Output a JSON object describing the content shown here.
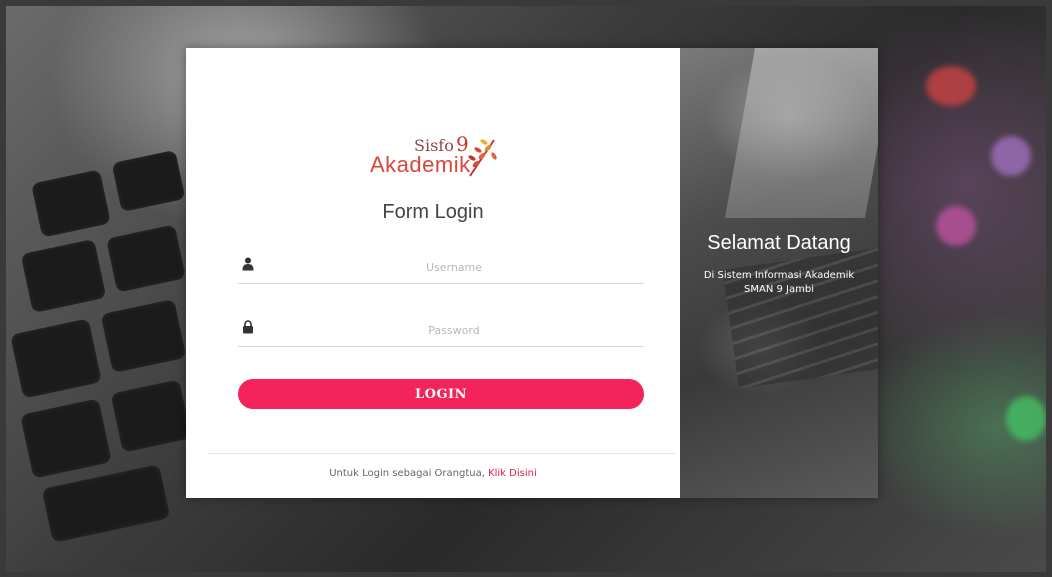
{
  "logo": {
    "line1": "Sisfo",
    "number": "9",
    "line2": "Akademik"
  },
  "form": {
    "title": "Form Login",
    "username": {
      "placeholder": "Username",
      "value": "",
      "icon": "user-icon"
    },
    "password": {
      "placeholder": "Password",
      "value": "",
      "icon": "lock-icon"
    },
    "login_label": "LOGIN"
  },
  "footer": {
    "text": "Untuk Login sebagai Orangtua,",
    "link": "Klik Disini"
  },
  "welcome": {
    "title": "Selamat Datang",
    "line1": "Di Sistem Informasi Akademik",
    "line2": "SMAN 9 Jambi"
  },
  "colors": {
    "accent": "#f5235b",
    "link": "#e21b4c",
    "logo_red": "#d9463a"
  }
}
